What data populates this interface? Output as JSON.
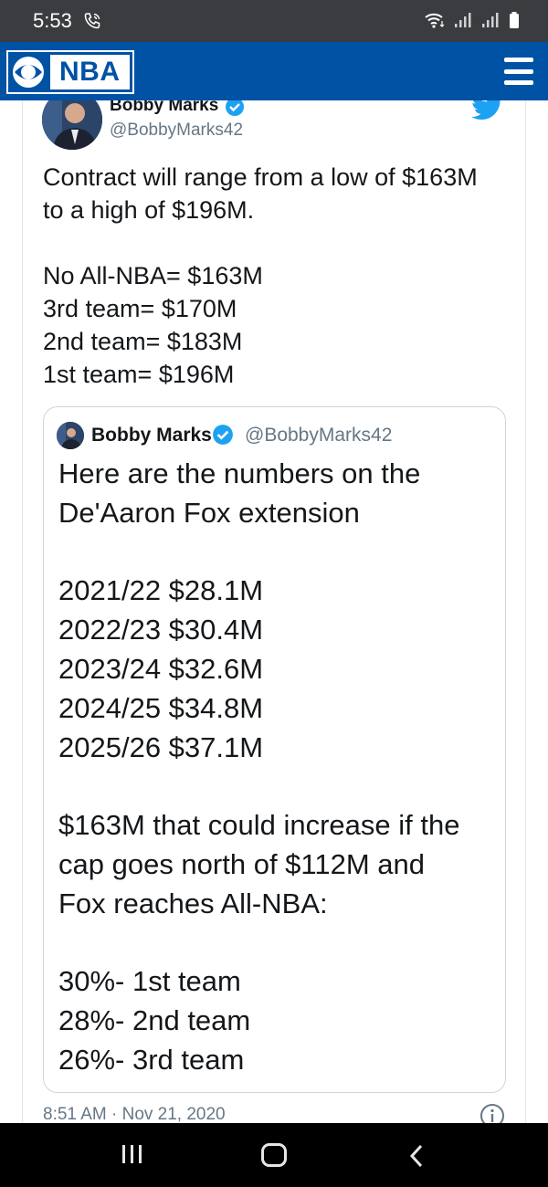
{
  "status_bar": {
    "time": "5:53"
  },
  "app_bar": {
    "logo_text": "NBA"
  },
  "tweet": {
    "author_name": "Bobby Marks",
    "author_handle": "@BobbyMarks42",
    "lines": [
      "Contract will range from a low of $163M",
      "to a high of $196M.",
      "",
      "No All-NBA= $163M",
      "3rd team= $170M",
      "2nd team= $183M",
      "1st team= $196M"
    ],
    "timestamp": "8:51 AM · Nov 21, 2020"
  },
  "quoted_tweet": {
    "author_name": "Bobby Marks",
    "author_handle": "@BobbyMarks42",
    "lines": [
      "Here are the numbers on the",
      "De'Aaron Fox extension",
      "",
      "2021/22 $28.1M",
      "2022/23 $30.4M",
      "2023/24 $32.6M",
      "2024/25 $34.8M",
      "2025/26 $37.1M",
      "",
      "$163M that could increase if the",
      "cap goes north of $112M and",
      "Fox reaches All-NBA:",
      "",
      "30%- 1st team",
      "28%- 2nd team",
      "26%- 3rd team"
    ]
  },
  "colors": {
    "app_bar": "#0052a5",
    "status_bar": "#3a3c40",
    "twitter_blue": "#1da1f2",
    "text": "#14171a",
    "muted": "#657786"
  },
  "icons": {
    "status": [
      "phone-call-icon",
      "wifi-icon",
      "signal-icon",
      "signal-icon",
      "battery-icon"
    ],
    "app": [
      "cbs-eye-icon",
      "hamburger-menu-icon"
    ],
    "tweet": [
      "verified-badge-icon",
      "twitter-bird-icon",
      "info-icon"
    ],
    "nav": [
      "recent-apps-icon",
      "home-icon",
      "back-icon"
    ]
  }
}
